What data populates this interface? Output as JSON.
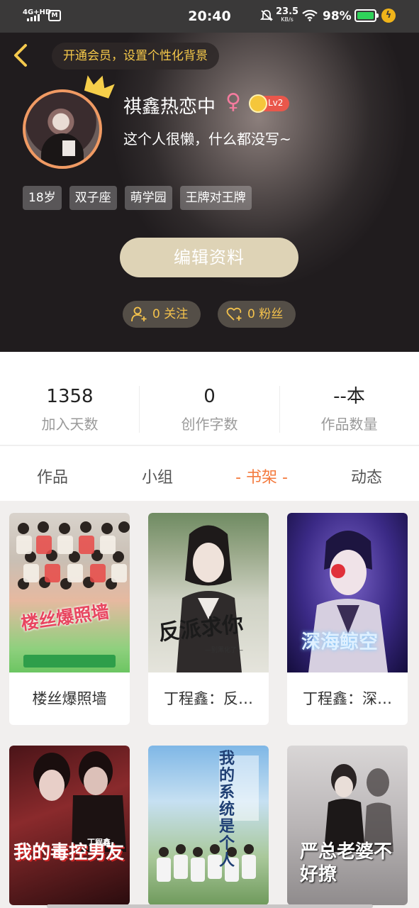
{
  "status_bar": {
    "network": "4G+HD",
    "time": "20:40",
    "speed_value": "23.5",
    "speed_unit": "KB/s",
    "battery": "98%"
  },
  "header": {
    "vip_tip": "开通会员，设置个性化背景",
    "username": "祺鑫热恋中",
    "gender_symbol": "♀",
    "level": "Lv2",
    "bio": "这个人很懒，什么都没写~",
    "tags": [
      "18岁",
      "双子座",
      "萌学园",
      "王牌对王牌"
    ],
    "edit_label": "编辑资料",
    "follow_label": "0 关注",
    "fans_label": "0 粉丝"
  },
  "stats": [
    {
      "value": "1358",
      "label": "加入天数"
    },
    {
      "value": "0",
      "label": "创作字数"
    },
    {
      "value": "--本",
      "label": "作品数量"
    }
  ],
  "tabs": [
    "作品",
    "小组",
    "- 书架 -",
    "动态"
  ],
  "active_tab": 2,
  "books": [
    {
      "title": "楼丝爆照墙",
      "cover_text": "楼丝爆照墙"
    },
    {
      "title": "丁程鑫：反…",
      "cover_text": "反派求你",
      "cover_sub": "—别黑化了—"
    },
    {
      "title": "丁程鑫：深…",
      "cover_text": "深海鲸空"
    },
    {
      "title": "",
      "cover_text": "我的毒控男友",
      "cover_sub": "丁程鑫"
    },
    {
      "title": "",
      "cover_text": "我的系统是个人"
    },
    {
      "title": "",
      "cover_text": "严总老婆不好撩"
    }
  ],
  "colors": {
    "accent": "#f47a3d",
    "vip_gold": "#f6c94a",
    "edit_button": "#ded3b6",
    "avatar_ring": "#f09a63"
  }
}
